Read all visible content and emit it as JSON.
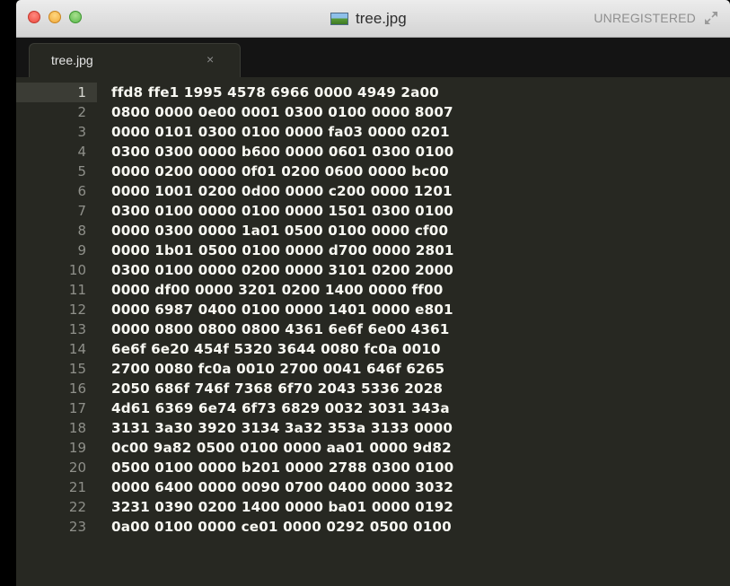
{
  "window": {
    "title": "tree.jpg",
    "title_icon": "image-file-icon",
    "unregistered_label": "UNREGISTERED",
    "colors": {
      "editor_bg": "#272822",
      "text": "#f8f8f2",
      "line_number": "#8f908a"
    }
  },
  "tabs": [
    {
      "label": "tree.jpg",
      "close_glyph": "×",
      "active": true
    }
  ],
  "editor": {
    "active_line": 1,
    "lines": [
      {
        "number": "1",
        "text": "ffd8 ffe1 1995 4578 6966 0000 4949 2a00"
      },
      {
        "number": "2",
        "text": "0800 0000 0e00 0001 0300 0100 0000 8007"
      },
      {
        "number": "3",
        "text": "0000 0101 0300 0100 0000 fa03 0000 0201"
      },
      {
        "number": "4",
        "text": "0300 0300 0000 b600 0000 0601 0300 0100"
      },
      {
        "number": "5",
        "text": "0000 0200 0000 0f01 0200 0600 0000 bc00"
      },
      {
        "number": "6",
        "text": "0000 1001 0200 0d00 0000 c200 0000 1201"
      },
      {
        "number": "7",
        "text": "0300 0100 0000 0100 0000 1501 0300 0100"
      },
      {
        "number": "8",
        "text": "0000 0300 0000 1a01 0500 0100 0000 cf00"
      },
      {
        "number": "9",
        "text": "0000 1b01 0500 0100 0000 d700 0000 2801"
      },
      {
        "number": "10",
        "text": "0300 0100 0000 0200 0000 3101 0200 2000"
      },
      {
        "number": "11",
        "text": "0000 df00 0000 3201 0200 1400 0000 ff00"
      },
      {
        "number": "12",
        "text": "0000 6987 0400 0100 0000 1401 0000 e801"
      },
      {
        "number": "13",
        "text": "0000 0800 0800 0800 4361 6e6f 6e00 4361"
      },
      {
        "number": "14",
        "text": "6e6f 6e20 454f 5320 3644 0080 fc0a 0010"
      },
      {
        "number": "15",
        "text": "2700 0080 fc0a 0010 2700 0041 646f 6265"
      },
      {
        "number": "16",
        "text": "2050 686f 746f 7368 6f70 2043 5336 2028"
      },
      {
        "number": "17",
        "text": "4d61 6369 6e74 6f73 6829 0032 3031 343a"
      },
      {
        "number": "18",
        "text": "3131 3a30 3920 3134 3a32 353a 3133 0000"
      },
      {
        "number": "19",
        "text": "0c00 9a82 0500 0100 0000 aa01 0000 9d82"
      },
      {
        "number": "20",
        "text": "0500 0100 0000 b201 0000 2788 0300 0100"
      },
      {
        "number": "21",
        "text": "0000 6400 0000 0090 0700 0400 0000 3032"
      },
      {
        "number": "22",
        "text": "3231 0390 0200 1400 0000 ba01 0000 0192"
      },
      {
        "number": "23",
        "text": "0a00 0100 0000 ce01 0000 0292 0500 0100"
      }
    ]
  }
}
